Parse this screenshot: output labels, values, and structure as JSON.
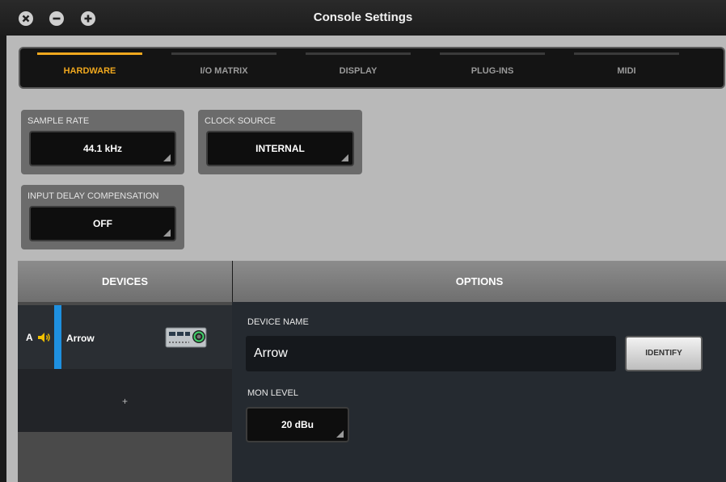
{
  "window": {
    "title": "Console Settings"
  },
  "tabs": [
    {
      "label": "HARDWARE",
      "active": true
    },
    {
      "label": "I/O MATRIX",
      "active": false
    },
    {
      "label": "DISPLAY",
      "active": false
    },
    {
      "label": "PLUG-INS",
      "active": false
    },
    {
      "label": "MIDI",
      "active": false
    }
  ],
  "hardware": {
    "sample_rate": {
      "label": "SAMPLE RATE",
      "value": "44.1 kHz"
    },
    "clock_source": {
      "label": "CLOCK SOURCE",
      "value": "INTERNAL"
    },
    "input_delay": {
      "label": "INPUT DELAY COMPENSATION",
      "value": "OFF"
    }
  },
  "devices": {
    "header": "DEVICES",
    "items": [
      {
        "letter": "A",
        "name": "Arrow",
        "icon": "speaker-icon"
      }
    ],
    "add_label": "+"
  },
  "options": {
    "header": "OPTIONS",
    "device_name_label": "DEVICE NAME",
    "device_name_value": "Arrow",
    "identify_label": "IDENTIFY",
    "mon_level_label": "MON LEVEL",
    "mon_level_value": "20 dBu"
  },
  "colors": {
    "accent": "#f0a81e",
    "selection": "#1e90e0"
  }
}
